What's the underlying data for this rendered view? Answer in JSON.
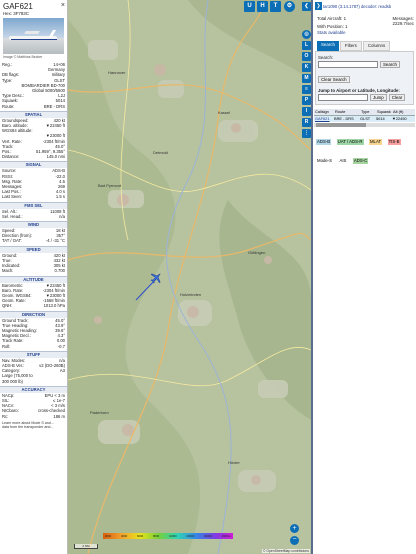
{
  "left": {
    "callsign": "GAF621",
    "hex_label": "Hex:",
    "hex": "3F783C",
    "image_credit": "Image © Matthias Becker",
    "fields_top": [
      {
        "k": "Reg.:",
        "v": "14+06"
      },
      {
        "k": "",
        "v": "Germany"
      },
      {
        "k": "DB flags:",
        "v": "military"
      },
      {
        "k": "Type:",
        "v": "GLST"
      },
      {
        "k": "",
        "v": "BOMBARDIER BD-700"
      },
      {
        "k": "",
        "v": "Global 5000/5500"
      },
      {
        "k": "Type Desc.:",
        "v": "L2J"
      },
      {
        "k": "Squawk:",
        "v": "5014"
      },
      {
        "k": "Route:",
        "v": "BRE - DRS"
      }
    ],
    "sections": [
      {
        "title": "SPATIAL",
        "rows": [
          {
            "k": "Groundspeed:",
            "v": "420 kt"
          },
          {
            "k": "Baro. altitude:",
            "v": "▼22450 ft"
          },
          {
            "k": "WGS84 altitude:",
            "v": ""
          },
          {
            "k": "",
            "v": "▼23000 ft"
          },
          {
            "k": "Vert. Rate:",
            "v": "-2304 ft/min"
          },
          {
            "k": "Track:",
            "v": "45.0°"
          },
          {
            "k": "Pos.:",
            "v": "51.959°, 9.355°"
          },
          {
            "k": "Distance:",
            "v": "145.0 nmi"
          }
        ]
      },
      {
        "title": "SIGNAL",
        "rows": [
          {
            "k": "Source:",
            "v": "ADS-B"
          },
          {
            "k": "RSSI:",
            "v": "-22.0"
          },
          {
            "k": "Msg. Rate:",
            "v": "4.5"
          },
          {
            "k": "Messages:",
            "v": "269"
          },
          {
            "k": "Last Pos.:",
            "v": "4.0 s"
          },
          {
            "k": "Last Seen:",
            "v": "1.5 s"
          }
        ]
      },
      {
        "title": "FMS SEL",
        "rows": [
          {
            "k": "Sel. Alt.:",
            "v": "11008 ft"
          },
          {
            "k": "Sel. Head.:",
            "v": "n/a"
          }
        ]
      },
      {
        "title": "WIND",
        "rows": [
          {
            "k": "Speed:",
            "v": "18 kt"
          },
          {
            "k": "Direction (from):",
            "v": "357°"
          },
          {
            "k": "TAT / OAT:",
            "v": "-4 / -31 °C"
          }
        ]
      },
      {
        "title": "SPEED",
        "rows": [
          {
            "k": "Ground:",
            "v": "420 kt"
          },
          {
            "k": "True:",
            "v": "432 kt"
          },
          {
            "k": "Indicated:",
            "v": "305 kt"
          },
          {
            "k": "Mach:",
            "v": "0.700"
          }
        ]
      },
      {
        "title": "ALTITUDE",
        "rows": [
          {
            "k": "Barometric:",
            "v": "▼22450 ft"
          },
          {
            "k": "Baro. Rate:",
            "v": "-2304 ft/min"
          },
          {
            "k": "Geom. WGS84:",
            "v": "▼23000 ft"
          },
          {
            "k": "Geom. Rate:",
            "v": "-1568 ft/min"
          },
          {
            "k": "QNH:",
            "v": "1013.0 hPa"
          }
        ]
      },
      {
        "title": "DIRECTION",
        "rows": [
          {
            "k": "Ground Track:",
            "v": "45.0°"
          },
          {
            "k": "True Heading:",
            "v": "43.9°"
          },
          {
            "k": "Magnetic Heading:",
            "v": "39.6°"
          },
          {
            "k": "Magnetic Decl.:",
            "v": "4.3°"
          },
          {
            "k": "Track Rate:",
            "v": "0.00"
          },
          {
            "k": "Roll:",
            "v": "-0.7"
          }
        ]
      },
      {
        "title": "STUFF",
        "rows": [
          {
            "k": "Nav. Modes:",
            "v": "n/a"
          },
          {
            "k": "ADS-B Ver.:",
            "v": "v2 (DO-260B)"
          },
          {
            "k": "Category:",
            "v": "A3"
          },
          {
            "k": "Large (75,000 to",
            "v": ""
          },
          {
            "k": "300 000 lb)",
            "v": ""
          }
        ]
      },
      {
        "title": "ACCURACY",
        "rows": [
          {
            "k": "NACp:",
            "v": "EPU < 3 m"
          },
          {
            "k": "SIL:",
            "v": "≤ 1e-7"
          },
          {
            "k": "NACv:",
            "v": "< 3 m/s"
          },
          {
            "k": "NICbaro:",
            "v": "cross-checked"
          },
          {
            "k": "Rc:",
            "v": "186 m"
          }
        ]
      }
    ],
    "footer": "Learn more about Mode S and...",
    "footer2": "data from the transponder and..."
  },
  "map": {
    "top_buttons": [
      "U",
      "H",
      "T"
    ],
    "side_buttons": [
      "L",
      "O",
      "K",
      "M",
      "P",
      "I",
      "R"
    ],
    "scale": "2 NM",
    "attribution": "© OpenStreetMap contributors",
    "altitude_ticks": [
      "2000",
      "4000",
      "6000",
      "8000",
      "10000",
      "20000",
      "30000",
      "40000+"
    ],
    "places": [
      {
        "n": "Hannover"
      },
      {
        "n": "Bad Pyrmont"
      },
      {
        "n": "Holzminden"
      },
      {
        "n": "Paderborn"
      },
      {
        "n": "Höxter"
      },
      {
        "n": "Kassel"
      },
      {
        "n": "Göttingen"
      },
      {
        "n": "Detmold"
      }
    ]
  },
  "right": {
    "version_line": "tar1090 (3.14.1787) decoder: readsb",
    "total_aircraft_label": "Total Aircraft:",
    "total_aircraft": "1",
    "with_position_label": "With Position:",
    "with_position": "1",
    "messages_label": "Messages:",
    "messages": "2229.7/sec",
    "stats_label": "Stats available",
    "tabs": [
      "Search",
      "Filters",
      "Columns"
    ],
    "search_label": "Search:",
    "search_button": "Search",
    "clear_search": "Clear Search",
    "jump_label": "Jump to Airport or Latitude, Longitude:",
    "jump_button": "Jump",
    "clear_button": "Clear",
    "table_headers": [
      "Callsign",
      "Route",
      "Type",
      "Squawk",
      "Alt (ft)"
    ],
    "table_row": {
      "callsign": "GAF621",
      "route": "BRE - DRS",
      "type": "GLST",
      "squawk": "5014",
      "alt": "▼22450"
    },
    "legend": [
      "ADS-B",
      "UAT / ADS-R",
      "MLAT",
      "TIS-B",
      "Mode-S",
      "AIS",
      "ADS-C"
    ],
    "colors": {
      "adsb": "#b2d6e8",
      "uat": "#9fd6a6",
      "mlat": "#f9d68f",
      "tisb": "#f9a0a0",
      "modes": "#e6e6e6",
      "ais": "#dcdcdc",
      "adsc": "#a6d4a0"
    }
  }
}
